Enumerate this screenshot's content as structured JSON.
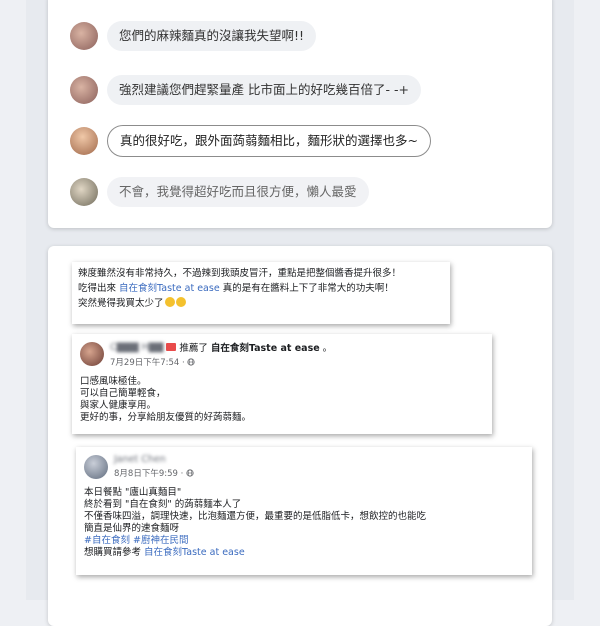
{
  "comments": [
    {
      "text": "您們的麻辣麵真的沒讓我失望啊!!"
    },
    {
      "text": "強烈建議您們趕緊量產 比市面上的好吃幾百倍了- -+"
    },
    {
      "text": "真的很好吃，跟外面蒟蒻麵相比，麵形狀的選擇也多~"
    },
    {
      "text": "不會，我覺得超好吃而且很方便，懶人最愛"
    }
  ],
  "note1": {
    "line1": "辣度雖然沒有非常持久，不過辣到我頭皮冒汗，重點是把整個醬香提升很多！",
    "line2_pre": "吃得出來",
    "line2_link": "自在食刻Taste at ease",
    "line2_post": "真的是有在醬料上下了非常大的功夫啊！",
    "line3": "突然覺得我買太少了"
  },
  "note2": {
    "name": "C▇▇▇ H▇▇",
    "recommend": "推薦了",
    "page": "自在食刻Taste at ease",
    "dot": "。",
    "date": "7月29日下午7:54 · ",
    "lines": [
      "口感風味極佳。",
      "可以自己簡單輕食，",
      "與家人健康享用。",
      "更好的事，分享給朋友優質的好蒟蒻麵。"
    ]
  },
  "note3": {
    "name": "Janet Chen",
    "date": "8月8日下午9:59 · ",
    "lines": [
      "本日餐點 \"廬山真麵目\"",
      "終於看到 \"自在食刻\" 的蒟蒻麵本人了",
      "不僅香味四溢，調理快速，比泡麵還方便，最重要的是低脂低卡，想飲控的也能吃",
      "簡直是仙界的速食麵呀"
    ],
    "hashtags": "#自在食刻 #廚神在民間",
    "buy_pre": "想購買請參考",
    "buy_link": "自在食刻Taste at ease"
  },
  "colors": {
    "link": "#3b6bbf",
    "bubble": "#eff1f4"
  },
  "icons": [
    "globe-icon",
    "flag-icon",
    "emoji-laugh-icon"
  ]
}
